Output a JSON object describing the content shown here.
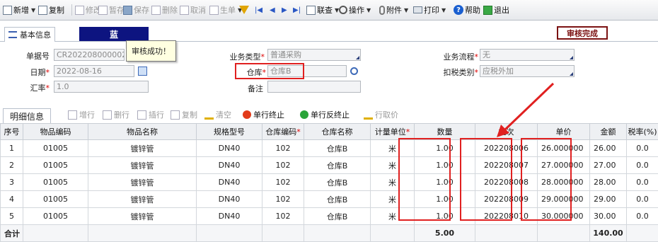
{
  "toolbar": {
    "new": "新增",
    "copy": "复制",
    "modify": "修改",
    "save_draft": "暂存",
    "save": "保存",
    "delete": "删除",
    "cancel": "取消",
    "generate": "生单",
    "query": "联查",
    "operate": "操作",
    "attachment": "附件",
    "print": "打印",
    "help": "帮助",
    "exit": "退出"
  },
  "tabs": {
    "basic_info": "基本信息",
    "color_tab": "蓝"
  },
  "status_stamp": "审核完成",
  "tooltip": "审核成功！",
  "form": {
    "doc_no_label": "单据号",
    "doc_no": "CR202208000002",
    "date_label": "日期",
    "date": "2022-08-16",
    "rate_label": "汇率",
    "rate": "1.0",
    "biz_type_label": "业务类型",
    "biz_type": "普通采购",
    "warehouse_label": "仓库",
    "warehouse": "仓库B",
    "remark_label": "备注",
    "remark": "",
    "flow_label": "业务流程",
    "flow": "无",
    "tax_type_label": "扣税类别",
    "tax_type": "应税外加"
  },
  "detail_toolbar": {
    "tab_label": "明细信息",
    "add_row": "增行",
    "delete_row": "删行",
    "insert_row": "插行",
    "copy_row": "复制",
    "clear": "清空",
    "terminate_row": "单行终止",
    "unterminate_row": "单行反终止",
    "fetch_price": "行取价"
  },
  "table": {
    "headers": [
      "序号",
      "物品编码",
      "物品名称",
      "规格型号",
      "仓库编码",
      "仓库名称",
      "计量单位",
      "数量",
      "批次",
      "单价",
      "金额",
      "税率(%)"
    ],
    "rows": [
      [
        "1",
        "01005",
        "镀锌管",
        "DN40",
        "102",
        "仓库B",
        "米",
        "1.00",
        "202208006",
        "26.000000",
        "26.00",
        "0.0"
      ],
      [
        "2",
        "01005",
        "镀锌管",
        "DN40",
        "102",
        "仓库B",
        "米",
        "1.00",
        "202208007",
        "27.000000",
        "27.00",
        "0.0"
      ],
      [
        "3",
        "01005",
        "镀锌管",
        "DN40",
        "102",
        "仓库B",
        "米",
        "1.00",
        "202208008",
        "28.000000",
        "28.00",
        "0.0"
      ],
      [
        "4",
        "01005",
        "镀锌管",
        "DN40",
        "102",
        "仓库B",
        "米",
        "1.00",
        "202208009",
        "29.000000",
        "29.00",
        "0.0"
      ],
      [
        "5",
        "01005",
        "镀锌管",
        "DN40",
        "102",
        "仓库B",
        "米",
        "1.00",
        "202208010",
        "30.000000",
        "30.00",
        "0.0"
      ]
    ],
    "total_label": "合计",
    "total_qty": "5.00",
    "total_amount": "140.00"
  },
  "colors": {
    "tab_blue": "#0d1480",
    "stamp": "#7b1212",
    "highlight": "#e02020"
  }
}
